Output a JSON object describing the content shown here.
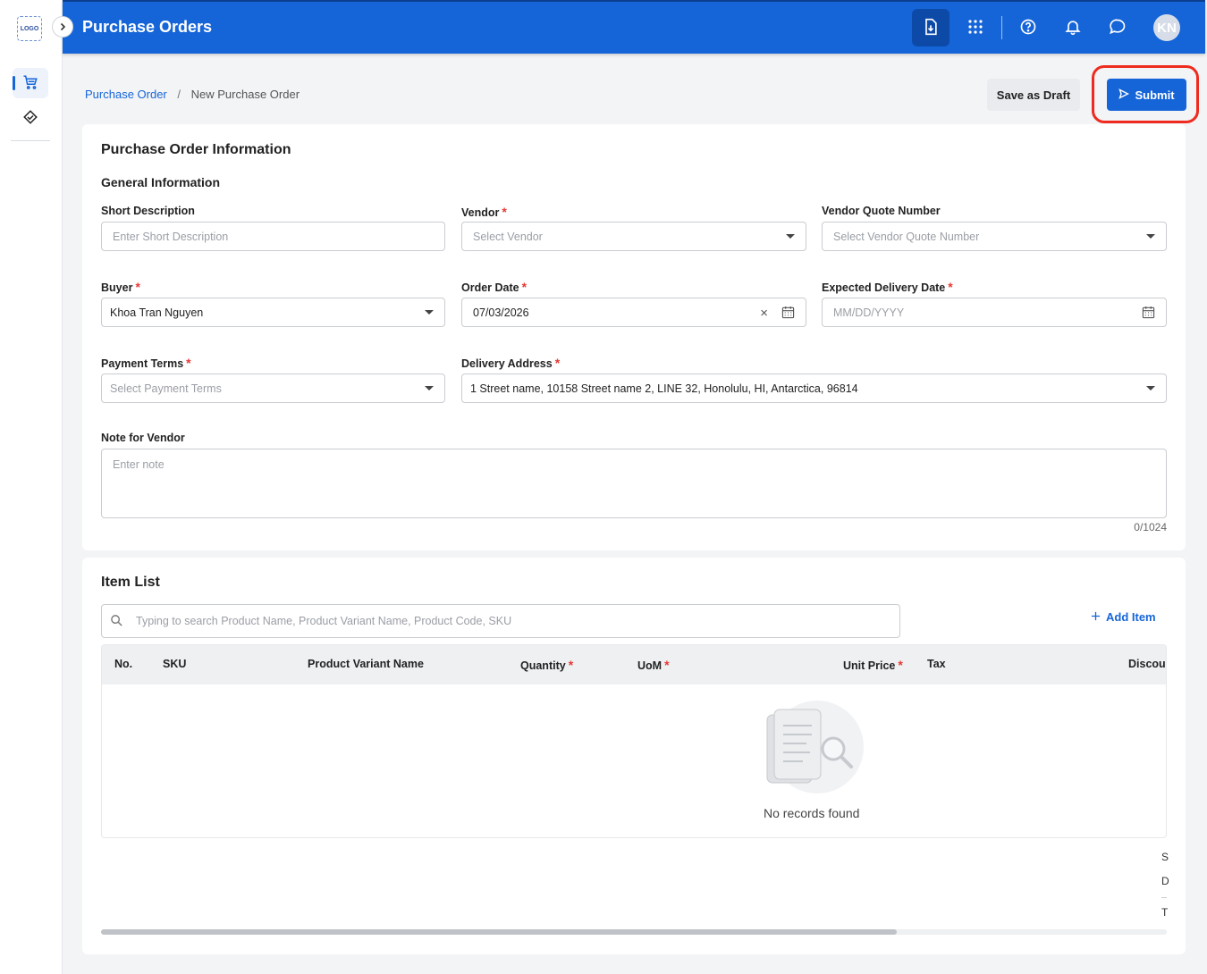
{
  "app": {
    "logo_text": "LOGO",
    "title": "Purchase Orders",
    "user_initials": "KN",
    "brand_color": "#1565d8"
  },
  "sidebar": {
    "items": [
      {
        "icon": "shopping-cart-icon",
        "active": true
      },
      {
        "icon": "handshake-icon",
        "active": false
      }
    ]
  },
  "header_icons": [
    "file-download-icon",
    "apps-grid-icon",
    "help-icon",
    "bell-icon",
    "chat-icon"
  ],
  "breadcrumb": {
    "parent": "Purchase Order",
    "separator": "/",
    "current": "New Purchase Order"
  },
  "actions": {
    "draft_label": "Save as Draft",
    "submit_label": "Submit"
  },
  "po_info": {
    "title": "Purchase Order Information",
    "section": "General Information",
    "short_description": {
      "label": "Short Description",
      "placeholder": "Enter Short Description"
    },
    "vendor": {
      "label": "Vendor",
      "placeholder": "Select Vendor",
      "required": true
    },
    "vendor_quote": {
      "label": "Vendor Quote Number",
      "placeholder": "Select Vendor Quote Number"
    },
    "buyer": {
      "label": "Buyer",
      "value": "Khoa Tran Nguyen",
      "required": true
    },
    "order_date": {
      "label": "Order Date",
      "value": "07/03/2026",
      "required": true
    },
    "expected_delivery": {
      "label": "Expected Delivery Date",
      "placeholder": "MM/DD/YYYY",
      "required": true
    },
    "payment_terms": {
      "label": "Payment Terms",
      "placeholder": "Select Payment Terms",
      "required": true
    },
    "delivery_address": {
      "label": "Delivery Address",
      "value": "1 Street name, 10158 Street name 2, LINE 32, Honolulu, HI, Antarctica, 96814",
      "required": true
    },
    "note": {
      "label": "Note for Vendor",
      "placeholder": "Enter note",
      "counter": "0/1024"
    }
  },
  "item_list": {
    "title": "Item List",
    "search_placeholder": "Typing to search Product Name, Product Variant Name, Product Code, SKU",
    "add_label": "Add Item",
    "columns": [
      {
        "label": "No.",
        "required": false
      },
      {
        "label": "SKU",
        "required": false
      },
      {
        "label": "Product Variant Name",
        "required": false
      },
      {
        "label": "Quantity",
        "required": true
      },
      {
        "label": "UoM",
        "required": true
      },
      {
        "label": "Unit Price",
        "required": true
      },
      {
        "label": "Tax",
        "required": false
      },
      {
        "label": "Discour",
        "required": false
      }
    ],
    "empty_text": "No records found",
    "summary_letters": [
      "S",
      "D",
      "T"
    ]
  },
  "required_mark": "*"
}
